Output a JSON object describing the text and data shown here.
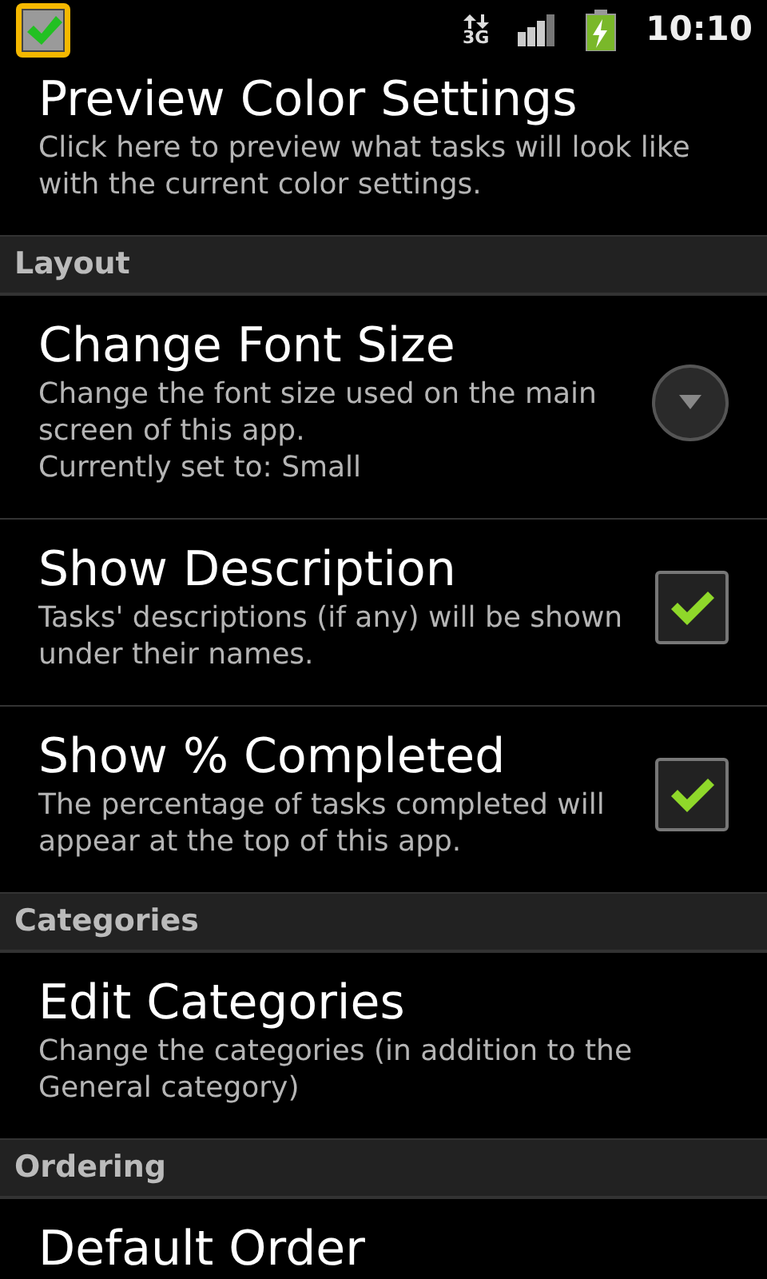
{
  "status_bar": {
    "time": "10:10",
    "network": "3G"
  },
  "items": [
    {
      "kind": "plain",
      "title": "Preview Color Settings",
      "summary": [
        "Click here to preview what tasks will look like with the current color settings."
      ]
    },
    {
      "kind": "header",
      "title": "Layout"
    },
    {
      "kind": "dropdown",
      "title": "Change Font Size",
      "summary": [
        "Change the font size used on the main screen of this app.",
        "Currently set to: Small"
      ]
    },
    {
      "kind": "checkbox",
      "title": "Show Description",
      "summary": [
        "Tasks' descriptions (if any) will be shown under their names."
      ],
      "checked": true
    },
    {
      "kind": "checkbox",
      "title": "Show % Completed",
      "summary": [
        "The percentage of tasks completed will appear at the top of this app."
      ],
      "checked": true
    },
    {
      "kind": "header",
      "title": "Categories"
    },
    {
      "kind": "plain",
      "title": "Edit Categories",
      "summary": [
        "Change the categories (in addition to the General category)"
      ]
    },
    {
      "kind": "header",
      "title": "Ordering"
    },
    {
      "kind": "plain",
      "title": "Default Order"
    }
  ]
}
